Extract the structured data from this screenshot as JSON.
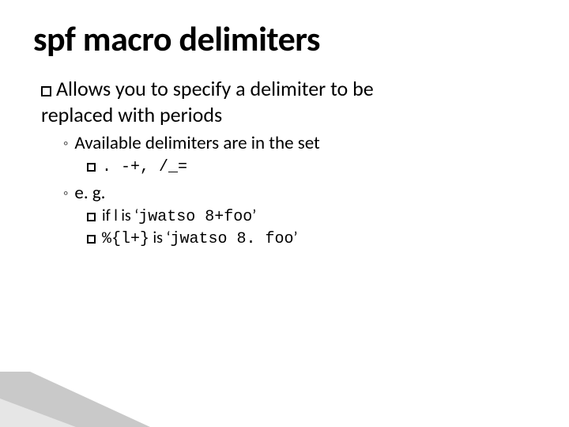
{
  "title": "spf macro delimiters",
  "lvl1": {
    "text_a": "Allows you to specify a delimiter to be",
    "text_b": "replaced with periods"
  },
  "lvl2_a": "Available delimiters are in the set",
  "lvl3_a": ". -+, /_=",
  "lvl2_b": "e. g.",
  "lvl3_b_pre": "if l is ‘",
  "lvl3_b_code": "jwatso 8+foo",
  "lvl3_b_post": "’",
  "lvl3_c_code1": "%{l+}",
  "lvl3_c_mid": " is ‘",
  "lvl3_c_code2": "jwatso 8. foo",
  "lvl3_c_post": "’"
}
